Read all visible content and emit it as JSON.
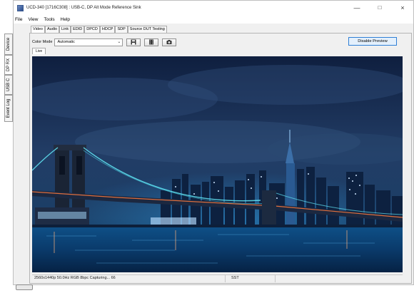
{
  "window": {
    "title": "UCD-340 [1716C308] : USB-C, DP Alt Mode Reference Sink",
    "controls": {
      "minimize": "—",
      "maximize": "□",
      "close": "×"
    }
  },
  "menu": [
    "File",
    "View",
    "Tools",
    "Help"
  ],
  "side_tabs": [
    "Device",
    "DP RX",
    "USB C",
    "Event Log"
  ],
  "tabs": [
    "Video",
    "Audio",
    "Link",
    "EDID",
    "DPCD",
    "HDCP",
    "SDP",
    "Source DUT Testing"
  ],
  "active_tab": "Video",
  "toolbar": {
    "color_mode_label": "Color Mode",
    "color_mode_value": "Automatic",
    "disable_preview_label": "Disable Preview",
    "icons": [
      "save-icon",
      "film-icon",
      "camera-icon"
    ]
  },
  "subtab": "Live",
  "status": {
    "text": "2560x1440p 50.0Hz RGB 8bpc Capturing... 66",
    "mode": "SST"
  },
  "colors": {
    "accent": "#2f7fd6",
    "window_bg": "#f0f0f0"
  }
}
